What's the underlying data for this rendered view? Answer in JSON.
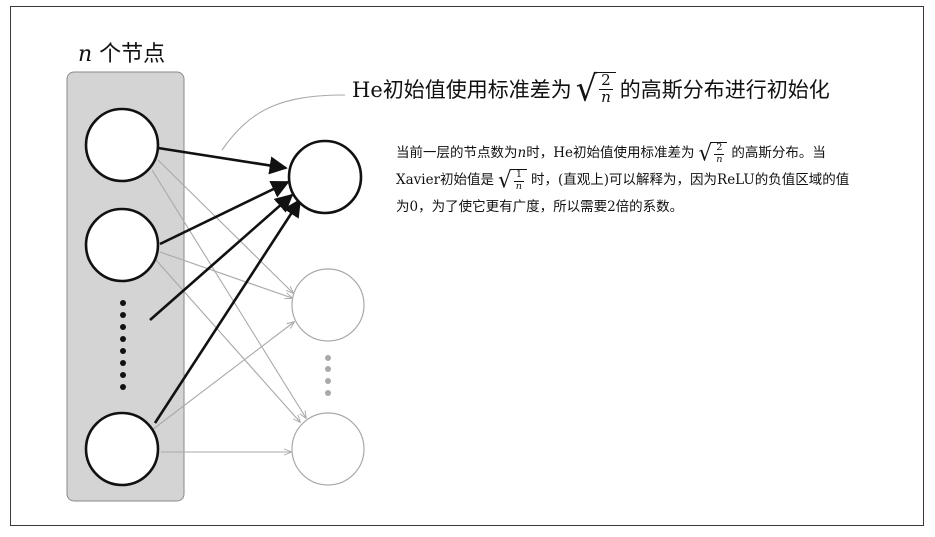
{
  "layer": {
    "var": "n",
    "label": "个节点"
  },
  "callout": {
    "prefix": "He初始值使用标准差为",
    "sqrt_num": "2",
    "sqrt_den": "n",
    "suffix": "的高斯分布进行初始化"
  },
  "desc": {
    "l1_a": "当前一层的节点数为",
    "l1_var": "n",
    "l1_b": "时，He初始值使用标准差为",
    "l1_num": "2",
    "l1_den": "n",
    "l1_c": "的高斯分布。当",
    "l2_a": "Xavier初始值是",
    "l2_num": "1",
    "l2_den": "n",
    "l2_b": "时，(直观上)可以解释为，因为ReLU的负值区域的值",
    "l3": "为0，为了使它更有广度，所以需要2倍的系数。"
  },
  "colors": {
    "accent": "#111111",
    "faded": "#a9a9a9",
    "panel": "#d4d4d4"
  }
}
